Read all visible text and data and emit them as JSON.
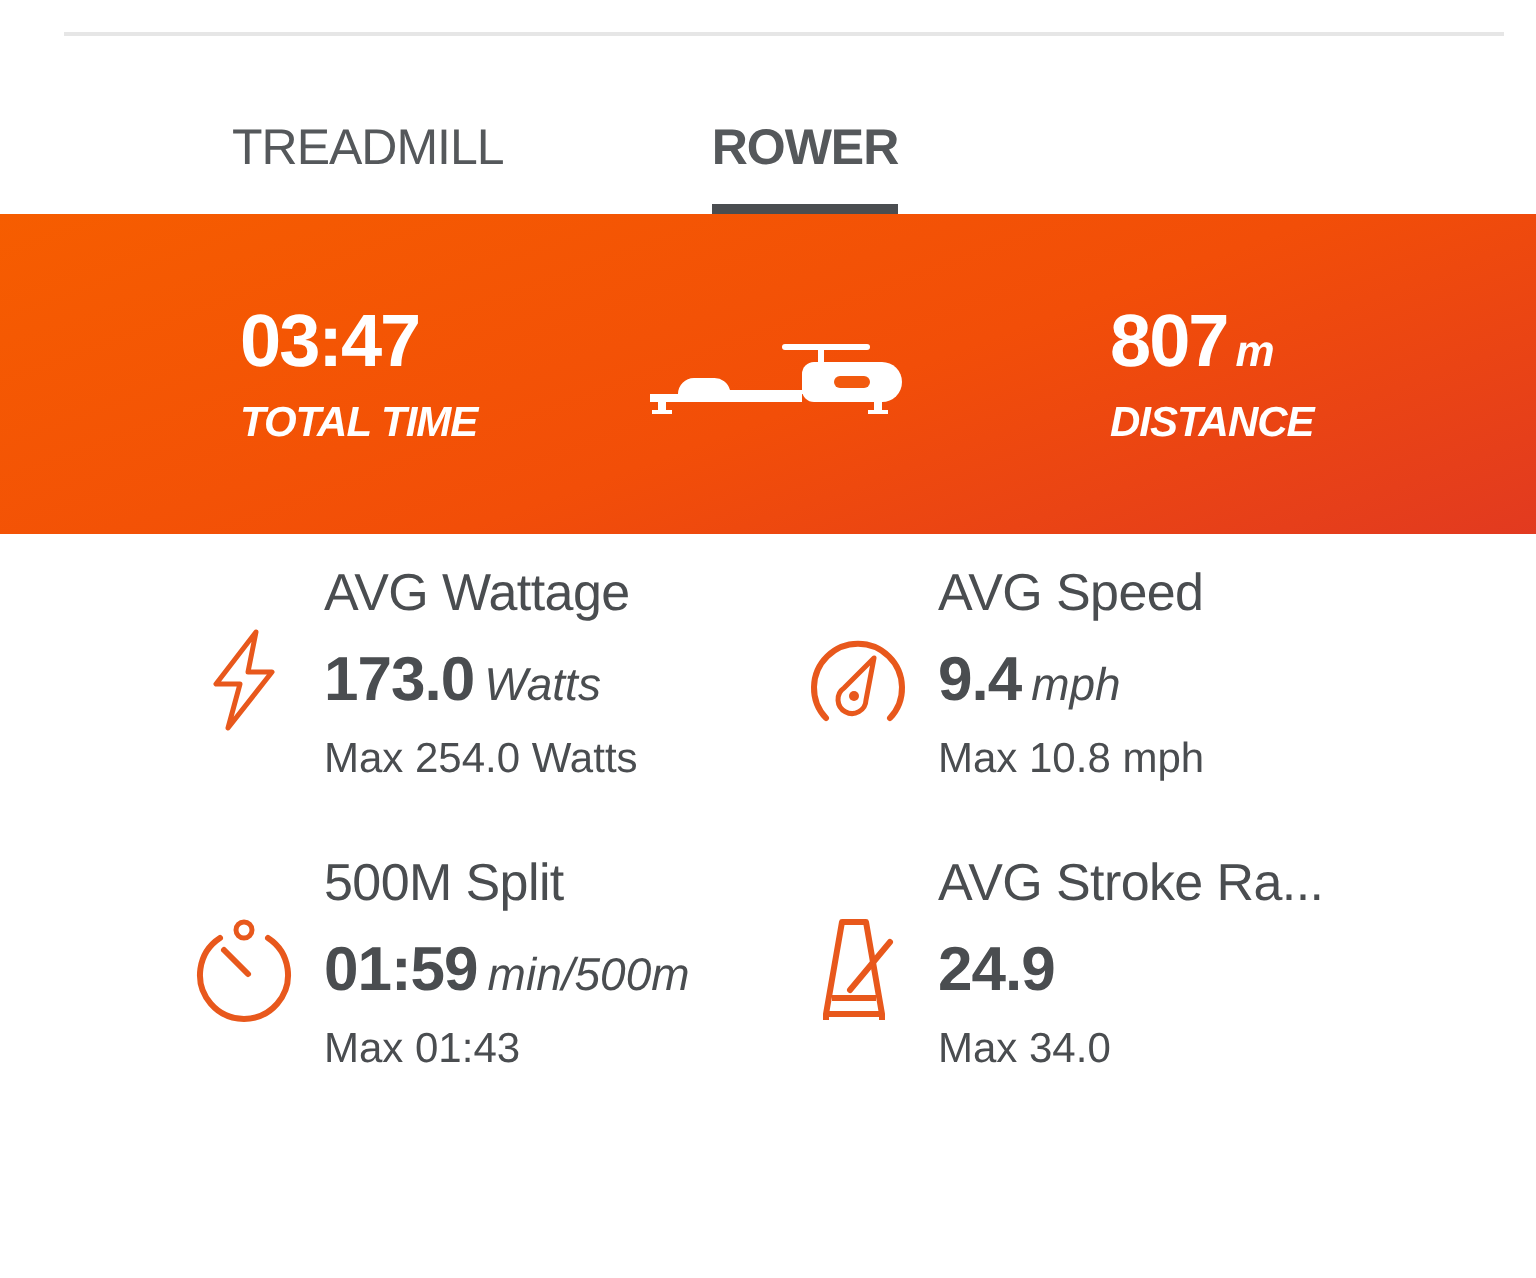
{
  "tabs": [
    {
      "label": "TREADMILL",
      "selected": false
    },
    {
      "label": "ROWER",
      "selected": true
    }
  ],
  "summary": [
    {
      "value": "03:47",
      "label": "TOTAL TIME"
    },
    {
      "value": "807",
      "unit": "m",
      "label": "DISTANCE"
    }
  ],
  "metrics": [
    {
      "title": "AVG Wattage",
      "value": "173.0",
      "unit": "Watts",
      "max": "Max 254.0 Watts"
    },
    {
      "title": "AVG Speed",
      "value": "9.4",
      "unit": "mph",
      "max": "Max 10.8 mph"
    },
    {
      "title": "500M Split",
      "value": "01:59",
      "unit": "min/500m",
      "max": "Max 01:43"
    },
    {
      "title": "AVG Stroke Ra...",
      "value": "24.9",
      "max": "Max 34.0"
    }
  ]
}
